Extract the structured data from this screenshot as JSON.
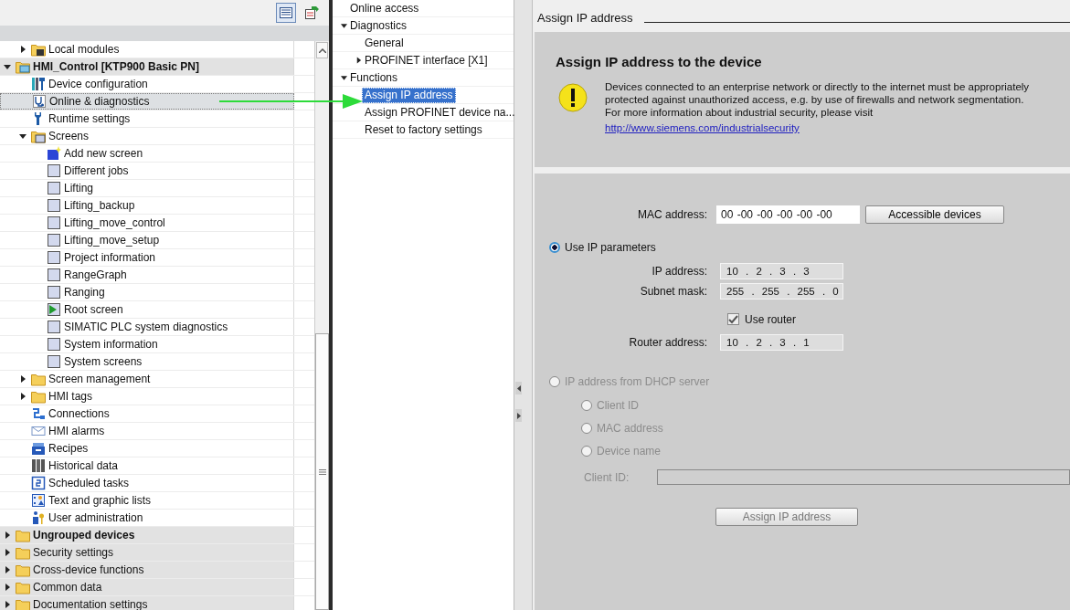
{
  "project_tree": {
    "toolbar": [
      {
        "selected": true
      },
      {
        "selected": false
      }
    ],
    "continued_children": [
      {
        "label": "Local modules",
        "kind": "module-folder",
        "expanded": false,
        "selected": false
      }
    ],
    "items": [
      {
        "label": "HMI_Control [KTP900 Basic PN]",
        "kind": "device",
        "expanded": true,
        "selected": false,
        "bold": true,
        "children": [
          {
            "label": "Device configuration",
            "kind": "device-config",
            "selected": false
          },
          {
            "label": "Online & diagnostics",
            "kind": "diagnostics",
            "selected": true
          },
          {
            "label": "Runtime settings",
            "kind": "wrench",
            "selected": false
          },
          {
            "label": "Screens",
            "kind": "screen-folder",
            "expanded": true,
            "selected": false,
            "children": [
              {
                "label": "Add new screen",
                "kind": "add-screen",
                "selected": false
              },
              {
                "label": "Different jobs",
                "kind": "screen",
                "selected": false
              },
              {
                "label": "Lifting",
                "kind": "screen",
                "selected": false
              },
              {
                "label": "Lifting_backup",
                "kind": "screen",
                "selected": false
              },
              {
                "label": "Lifting_move_control",
                "kind": "screen",
                "selected": false
              },
              {
                "label": "Lifting_move_setup",
                "kind": "screen",
                "selected": false
              },
              {
                "label": "Project information",
                "kind": "screen",
                "selected": false
              },
              {
                "label": "RangeGraph",
                "kind": "screen",
                "selected": false
              },
              {
                "label": "Ranging",
                "kind": "screen",
                "selected": false
              },
              {
                "label": "Root screen",
                "kind": "root-screen",
                "selected": false
              },
              {
                "label": "SIMATIC PLC system diagnostics",
                "kind": "screen",
                "selected": false
              },
              {
                "label": "System information",
                "kind": "screen",
                "selected": false
              },
              {
                "label": "System screens",
                "kind": "screen",
                "selected": false
              }
            ]
          },
          {
            "label": "Screen management",
            "kind": "folder",
            "expanded": false,
            "selected": false
          },
          {
            "label": "HMI tags",
            "kind": "folder",
            "expanded": false,
            "selected": false
          },
          {
            "label": "Connections",
            "kind": "connections",
            "selected": false
          },
          {
            "label": "HMI alarms",
            "kind": "alarms",
            "selected": false
          },
          {
            "label": "Recipes",
            "kind": "recipes",
            "selected": false
          },
          {
            "label": "Historical data",
            "kind": "archive",
            "selected": false
          },
          {
            "label": "Scheduled tasks",
            "kind": "tasks",
            "selected": false
          },
          {
            "label": "Text and graphic lists",
            "kind": "lists",
            "selected": false
          },
          {
            "label": "User administration",
            "kind": "users",
            "selected": false
          }
        ]
      },
      {
        "label": "Ungrouped devices",
        "kind": "folder",
        "expanded": false,
        "selected": false,
        "bold": true
      },
      {
        "label": "Security settings",
        "kind": "folder",
        "expanded": false,
        "selected": false,
        "bold": false
      },
      {
        "label": "Cross-device functions",
        "kind": "folder",
        "expanded": false,
        "selected": false,
        "bold": false
      },
      {
        "label": "Common data",
        "kind": "folder",
        "expanded": false,
        "selected": false,
        "bold": false
      },
      {
        "label": "Documentation settings",
        "kind": "folder",
        "expanded": false,
        "selected": false,
        "bold": false
      }
    ]
  },
  "navigation": {
    "items": [
      {
        "label": "Online access",
        "selected": false
      },
      {
        "label": "Diagnostics",
        "expanded": true,
        "selected": false,
        "children": [
          {
            "label": "General",
            "selected": false
          },
          {
            "label": "PROFINET interface [X1]",
            "expanded": false,
            "selected": false
          }
        ]
      },
      {
        "label": "Functions",
        "expanded": true,
        "selected": false,
        "children": [
          {
            "label": "Assign IP address",
            "selected": true
          },
          {
            "label": "Assign PROFINET device na...",
            "selected": false
          },
          {
            "label": "Reset to factory settings",
            "selected": false
          }
        ]
      }
    ]
  },
  "editor": {
    "section_title": "Assign IP address",
    "info": {
      "heading": "Assign IP address to the device",
      "text": "Devices connected to an enterprise network or directly to the internet must be appropriately protected against unauthorized access, e.g. by use of firewalls and network segmentation.",
      "more": "For more information about industrial security, please visit",
      "link": "http://www.siemens.com/industrialsecurity"
    },
    "mac": {
      "label": "MAC address:",
      "value": "00 -00 -00 -00 -00 -00"
    },
    "accessible_button": "Accessible devices",
    "use_ip": {
      "label": "Use IP parameters",
      "selected": true
    },
    "ip_fields": [
      {
        "label": "IP address:",
        "value": "10 . 2 . 3 . 3"
      },
      {
        "label": "Subnet mask:",
        "value": "255 . 255 . 255 . 0"
      }
    ],
    "use_router": {
      "label": "Use router",
      "checked": true
    },
    "router": {
      "label": "Router address:",
      "value": "10 . 2 . 3 . 1"
    },
    "dhcp": {
      "label": "IP address from DHCP server",
      "selected": false,
      "disabled": true,
      "options": [
        {
          "label": "Client ID",
          "selected": false
        },
        {
          "label": "MAC address",
          "selected": false
        },
        {
          "label": "Device name",
          "selected": false
        }
      ],
      "client_id": {
        "label": "Client ID:"
      }
    },
    "assign_button": {
      "label": "Assign IP address",
      "disabled": true
    }
  }
}
